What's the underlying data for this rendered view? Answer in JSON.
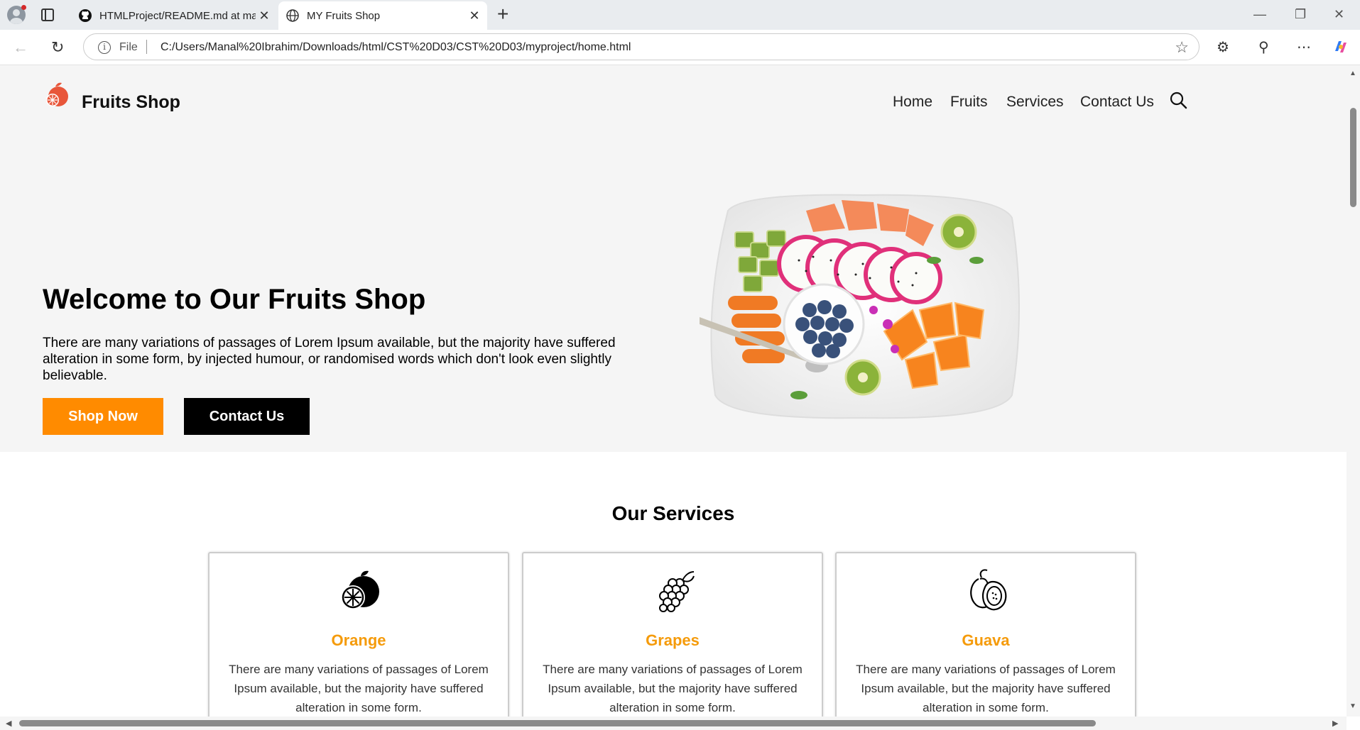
{
  "browser": {
    "tabs": [
      {
        "title": "HTMLProject/README.md at mai",
        "icon": "github-icon"
      },
      {
        "title": "MY Fruits Shop",
        "icon": "globe-icon"
      }
    ],
    "address": {
      "scheme": "File",
      "url": "C:/Users/Manal%20Ibrahim/Downloads/html/CST%20D03/CST%20D03/myproject/home.html"
    }
  },
  "nav": {
    "brand": "Fruits Shop",
    "links": [
      "Home",
      "Fruits",
      "Services",
      "Contact Us"
    ]
  },
  "hero": {
    "title": "Welcome to Our Fruits Shop",
    "text": "There are many variations of passages of Lorem Ipsum available, but the majority have suffered alteration in some form, by injected humour, or randomised words which don't look even slightly believable.",
    "primary_button": "Shop Now",
    "secondary_button": "Contact Us"
  },
  "services": {
    "title": "Our Services",
    "cards": [
      {
        "title": "Orange",
        "icon": "orange-icon",
        "text": "There are many variations of passages of Lorem Ipsum available, but the majority have suffered alteration in some form."
      },
      {
        "title": "Grapes",
        "icon": "grapes-icon",
        "text": "There are many variations of passages of Lorem Ipsum available, but the majority have suffered alteration in some form."
      },
      {
        "title": "Guava",
        "icon": "guava-icon",
        "text": "There are many variations of passages of Lorem Ipsum available, but the majority have suffered alteration in some form."
      }
    ]
  },
  "colors": {
    "accent": "#ff8b00",
    "card_title": "#f59b0b",
    "hero_bg": "#f5f5f5"
  }
}
